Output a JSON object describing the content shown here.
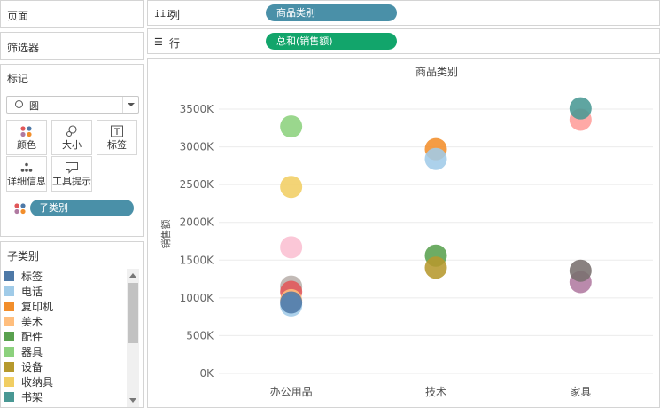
{
  "sidebar": {
    "pages_title": "页面",
    "filters_title": "筛选器",
    "marks": {
      "title": "标记",
      "mark_type": "圆",
      "buttons": [
        {
          "label": "颜色",
          "icon": "color-dots-icon"
        },
        {
          "label": "大小",
          "icon": "size-icon"
        },
        {
          "label": "标签",
          "icon": "text-label-icon"
        },
        {
          "label": "详细信息",
          "icon": "detail-dots-icon"
        },
        {
          "label": "工具提示",
          "icon": "tooltip-icon"
        }
      ],
      "color_pill": "子类别"
    },
    "legend": {
      "title": "子类别",
      "items": [
        {
          "label": "标签",
          "color": "#4e79a7"
        },
        {
          "label": "电话",
          "color": "#a0cbe8"
        },
        {
          "label": "复印机",
          "color": "#f28e2b"
        },
        {
          "label": "美术",
          "color": "#ffbe7d"
        },
        {
          "label": "配件",
          "color": "#59a14f"
        },
        {
          "label": "器具",
          "color": "#8cd17d"
        },
        {
          "label": "设备",
          "color": "#b6992d"
        },
        {
          "label": "收纳具",
          "color": "#f1ce63"
        },
        {
          "label": "书架",
          "color": "#499894"
        }
      ]
    }
  },
  "shelves": {
    "columns_label": "列",
    "columns_pill": "商品类别",
    "rows_label": "行",
    "rows_pill": "总和(销售额)"
  },
  "chart_data": {
    "type": "scatter",
    "title": "商品类别",
    "xlabel": "",
    "ylabel": "销售额",
    "categories": [
      "办公用品",
      "技术",
      "家具"
    ],
    "ylim": [
      0,
      3700000
    ],
    "yticks": [
      0,
      500000,
      1000000,
      1500000,
      2000000,
      2500000,
      3000000,
      3500000
    ],
    "ytick_labels": [
      "0K",
      "500K",
      "1000K",
      "1500K",
      "2000K",
      "2500K",
      "3000K",
      "3500K"
    ],
    "grid": true,
    "points": [
      {
        "category": "办公用品",
        "value": 3270000,
        "color": "#8cd17d"
      },
      {
        "category": "办公用品",
        "value": 2470000,
        "color": "#f1ce63"
      },
      {
        "category": "办公用品",
        "value": 1670000,
        "color": "#fabfd2"
      },
      {
        "category": "办公用品",
        "value": 1150000,
        "color": "#bab0ac"
      },
      {
        "category": "办公用品",
        "value": 1080000,
        "color": "#e15759"
      },
      {
        "category": "办公用品",
        "value": 970000,
        "color": "#ffbe7d"
      },
      {
        "category": "办公用品",
        "value": 900000,
        "color": "#a0cbe8"
      },
      {
        "category": "办公用品",
        "value": 940000,
        "color": "#4e79a7"
      },
      {
        "category": "技术",
        "value": 2970000,
        "color": "#f28e2b"
      },
      {
        "category": "技术",
        "value": 2840000,
        "color": "#a0cbe8"
      },
      {
        "category": "技术",
        "value": 1560000,
        "color": "#59a14f"
      },
      {
        "category": "技术",
        "value": 1400000,
        "color": "#b6992d"
      },
      {
        "category": "家具",
        "value": 3360000,
        "color": "#ff9d9a"
      },
      {
        "category": "家具",
        "value": 3510000,
        "color": "#499894"
      },
      {
        "category": "家具",
        "value": 1210000,
        "color": "#b07aa1"
      },
      {
        "category": "家具",
        "value": 1360000,
        "color": "#79706e"
      }
    ]
  }
}
